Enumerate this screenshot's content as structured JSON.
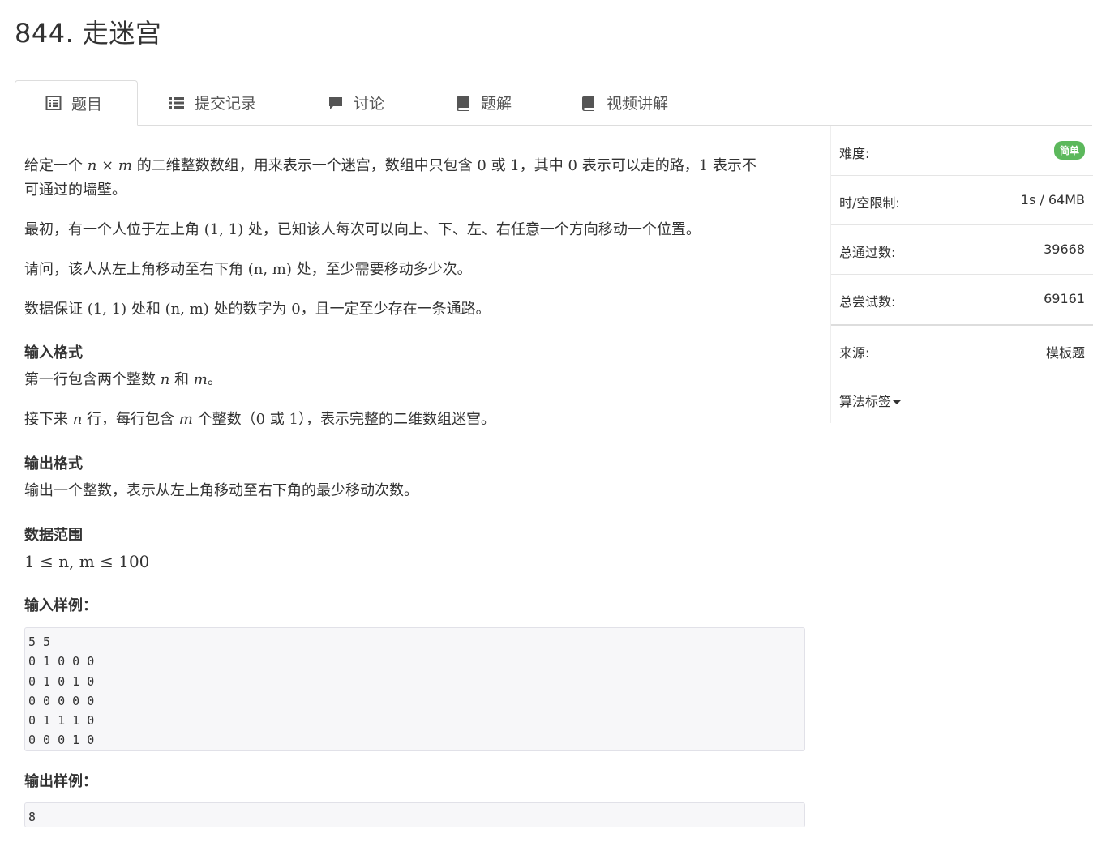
{
  "page_title": "844. 走迷宫",
  "tabs": [
    {
      "label": "题目",
      "icon": "list-alt-icon"
    },
    {
      "label": "提交记录",
      "icon": "list-icon"
    },
    {
      "label": "讨论",
      "icon": "comment-icon"
    },
    {
      "label": "题解",
      "icon": "book-icon"
    },
    {
      "label": "视频讲解",
      "icon": "book-icon"
    }
  ],
  "sidebar": {
    "difficulty_label": "难度:",
    "difficulty_value": "简单",
    "limit_label": "时/空限制:",
    "limit_value": "1s / 64MB",
    "passed_label": "总通过数:",
    "passed_value": "39668",
    "attempts_label": "总尝试数:",
    "attempts_value": "69161",
    "source_label": "来源:",
    "source_value": "模板题",
    "tags_label": "算法标签"
  },
  "problem": {
    "p1a": "给定一个 ",
    "p1b": " 的二维整数数组，用来表示一个迷宫，数组中只包含 ",
    "p1c": " 或 ",
    "p1d": "，其中 ",
    "p1e": " 表示可以走的路，",
    "p1f": " 表示不",
    "p1g": "可通过的墙壁。",
    "p2a": "最初，有一个人位于左上角 ",
    "p2b": " 处，已知该人每次可以向上、下、左、右任意一个方向移动一个位置。",
    "p3a": "请问，该人从左上角移动至右下角 ",
    "p3b": " 处，至少需要移动多少次。",
    "p4a": "数据保证 ",
    "p4b": " 处和 ",
    "p4c": " 处的数字为 ",
    "p4d": "，且一定至少存在一条通路。",
    "input_heading": "输入格式",
    "in1a": "第一行包含两个整数 ",
    "in1b": " 和 ",
    "in1c": "。",
    "in2a": "接下来 ",
    "in2b": " 行，每行包含 ",
    "in2c": " 个整数（",
    "in2d": " 或 ",
    "in2e": "），表示完整的二维数组迷宫。",
    "output_heading": "输出格式",
    "out1": "输出一个整数，表示从左上角移动至右下角的最少移动次数。",
    "range_heading": "数据范围",
    "sample_in_heading": "输入样例：",
    "sample_in": "5 5\n0 1 0 0 0\n0 1 0 1 0\n0 0 0 0 0\n0 1 1 1 0\n0 0 0 1 0",
    "sample_out_heading": "输出样例：",
    "sample_out": "8"
  },
  "math": {
    "n": "n",
    "m": "m",
    "times": "×",
    "zero": "0",
    "one": "1",
    "pt11": "(1, 1)",
    "ptnm": "(n, m)",
    "range": "1 ≤ n, m ≤ 100"
  }
}
